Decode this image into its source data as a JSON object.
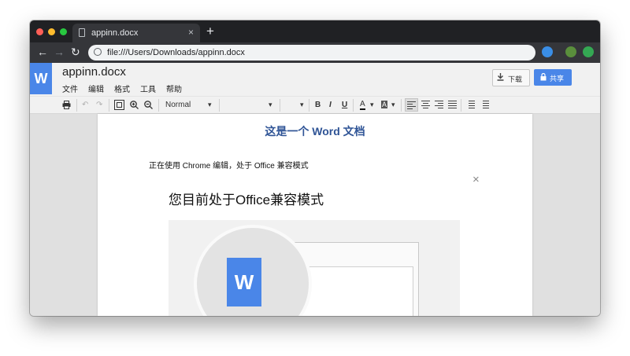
{
  "browser": {
    "tab_title": "appinn.docx",
    "tab_close": "×",
    "new_tab": "+",
    "url": "file:///Users/Downloads/appinn.docx",
    "nav_back": "←",
    "nav_forward": "→",
    "nav_reload": "↻"
  },
  "app": {
    "logo_letter": "W",
    "doc_title": "appinn.docx",
    "menu": [
      "文件",
      "编辑",
      "格式",
      "工具",
      "帮助"
    ],
    "download_label": "下载",
    "share_label": "共享"
  },
  "toolbar": {
    "style_value": "Normal",
    "bold": "B",
    "italic": "I",
    "underline": "U",
    "font_color": "A",
    "highlight": "A"
  },
  "document": {
    "heading": "这是一个 Word 文档",
    "paragraph": "正在使用 Chrome 编辑，处于 Office 兼容模式",
    "dialog_title": "您目前处于Office兼容模式",
    "dialog_close": "×",
    "illustration_letter": "W"
  },
  "colors": {
    "accent": "#4a86e8",
    "heading": "#2f5496"
  }
}
